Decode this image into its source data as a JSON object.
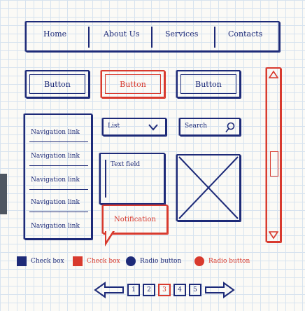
{
  "nav": {
    "items": [
      "Home",
      "About Us",
      "Services",
      "Contacts"
    ]
  },
  "buttons": [
    "Button",
    "Button",
    "Button"
  ],
  "navlinks": [
    "Navigation link",
    "Navigation link",
    "Navigation link",
    "Navigation link",
    "Navigation link"
  ],
  "inputs": {
    "list_label": "List",
    "search_label": "Search",
    "textfield_label": "Text field"
  },
  "notification": {
    "text": "Notification"
  },
  "controls": {
    "checkbox1": "Check box",
    "checkbox2": "Check box",
    "radio1": "Radio button",
    "radio2": "Radio button"
  },
  "pager": [
    "1",
    "2",
    "3",
    "4",
    "5"
  ],
  "colors": {
    "ink": "#1d2a78",
    "accent": "#d83a2e"
  }
}
